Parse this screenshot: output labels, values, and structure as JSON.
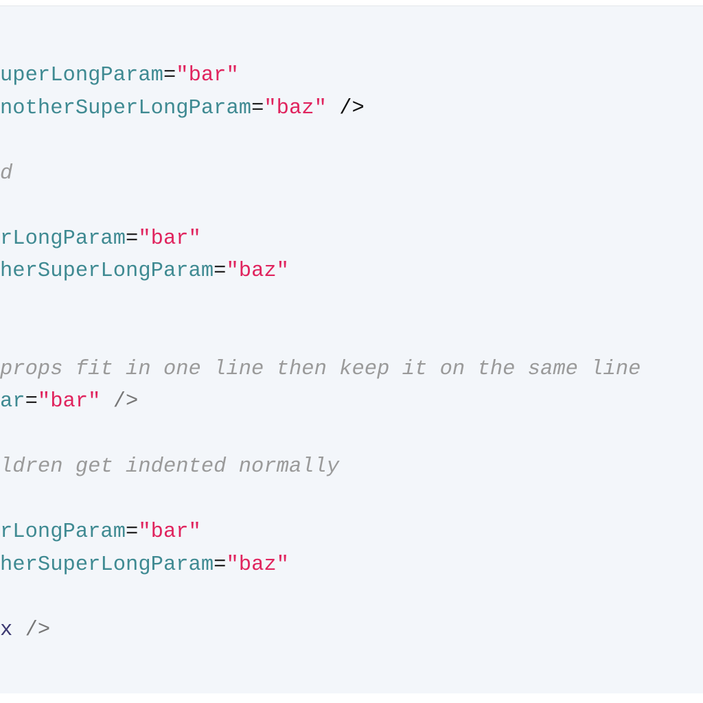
{
  "code_lines": [
    {
      "parts": [
        {
          "t": "uperLongParam",
          "c": "attr"
        },
        {
          "t": "=",
          "c": "eq"
        },
        {
          "t": "\"bar\"",
          "c": "str"
        }
      ]
    },
    {
      "parts": [
        {
          "t": "notherSuperLongParam",
          "c": "attr"
        },
        {
          "t": "=",
          "c": "eq"
        },
        {
          "t": "\"baz\"",
          "c": "str"
        },
        {
          "t": " />",
          "c": "punc-dark"
        }
      ]
    },
    {
      "parts": []
    },
    {
      "parts": [
        {
          "t": "d",
          "c": "cmt"
        }
      ]
    },
    {
      "parts": []
    },
    {
      "parts": [
        {
          "t": "rLongParam",
          "c": "attr"
        },
        {
          "t": "=",
          "c": "eq"
        },
        {
          "t": "\"bar\"",
          "c": "str"
        }
      ]
    },
    {
      "parts": [
        {
          "t": "herSuperLongParam",
          "c": "attr"
        },
        {
          "t": "=",
          "c": "eq"
        },
        {
          "t": "\"baz\"",
          "c": "str"
        }
      ]
    },
    {
      "parts": []
    },
    {
      "parts": []
    },
    {
      "parts": [
        {
          "t": "props fit in one line then keep it on the same line",
          "c": "cmt"
        }
      ]
    },
    {
      "parts": [
        {
          "t": "ar",
          "c": "attr"
        },
        {
          "t": "=",
          "c": "eq"
        },
        {
          "t": "\"bar\"",
          "c": "str"
        },
        {
          "t": " />",
          "c": "punc"
        }
      ]
    },
    {
      "parts": []
    },
    {
      "parts": [
        {
          "t": "ldren get indented normally",
          "c": "cmt"
        }
      ]
    },
    {
      "parts": []
    },
    {
      "parts": [
        {
          "t": "rLongParam",
          "c": "attr"
        },
        {
          "t": "=",
          "c": "eq"
        },
        {
          "t": "\"bar\"",
          "c": "str"
        }
      ]
    },
    {
      "parts": [
        {
          "t": "herSuperLongParam",
          "c": "attr"
        },
        {
          "t": "=",
          "c": "eq"
        },
        {
          "t": "\"baz\"",
          "c": "str"
        }
      ]
    },
    {
      "parts": []
    },
    {
      "parts": [
        {
          "t": "x",
          "c": "tag"
        },
        {
          "t": " />",
          "c": "punc"
        }
      ]
    }
  ]
}
